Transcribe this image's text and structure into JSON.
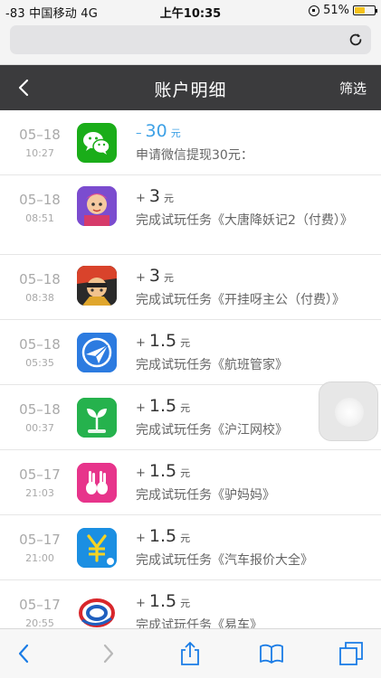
{
  "status_bar": {
    "carrier": "-83 中国移动  4G",
    "time": "上午10:35",
    "battery": "51%",
    "battery_level": 0.51
  },
  "browser": {
    "reload_icon": "reload-icon"
  },
  "nav": {
    "title": "账户明细",
    "filter_label": "筛选",
    "back_icon": "chevron-left-icon"
  },
  "records": [
    {
      "date": "05–18",
      "time": "10:27",
      "sign": "–",
      "amount": "30",
      "unit": "元",
      "desc": "申请微信提现30元：",
      "icon": "wechat-icon",
      "negative": true
    },
    {
      "date": "05–18",
      "time": "08:51",
      "sign": "+",
      "amount": "3",
      "unit": "元",
      "desc": "完成试玩任务《大唐降妖记2（付费）》",
      "icon": "game-datang-icon"
    },
    {
      "date": "05–18",
      "time": "08:38",
      "sign": "+",
      "amount": "3",
      "unit": "元",
      "desc": "完成试玩任务《开挂呀主公（付费）》",
      "icon": "game-kaigua-icon"
    },
    {
      "date": "05–18",
      "time": "05:35",
      "sign": "+",
      "amount": "1.5",
      "unit": "元",
      "desc": "完成试玩任务《航班管家》",
      "icon": "plane-icon"
    },
    {
      "date": "05–18",
      "time": "00:37",
      "sign": "+",
      "amount": "1.5",
      "unit": "元",
      "desc": "完成试玩任务《沪江网校》",
      "icon": "sprout-icon"
    },
    {
      "date": "05–17",
      "time": "21:03",
      "sign": "+",
      "amount": "1.5",
      "unit": "元",
      "desc": "完成试玩任务《驴妈妈》",
      "icon": "rabbit-icon"
    },
    {
      "date": "05–17",
      "time": "21:00",
      "sign": "+",
      "amount": "1.5",
      "unit": "元",
      "desc": "完成试玩任务《汽车报价大全》",
      "icon": "yuan-icon"
    },
    {
      "date": "05–17",
      "time": "20:55",
      "sign": "+",
      "amount": "1.5",
      "unit": "元",
      "desc": "完成试玩任务《易车》",
      "icon": "yiche-logo-icon"
    }
  ],
  "toolbar": {
    "icons": [
      "back-icon",
      "forward-icon",
      "share-icon",
      "bookmarks-icon",
      "tabs-icon"
    ]
  }
}
